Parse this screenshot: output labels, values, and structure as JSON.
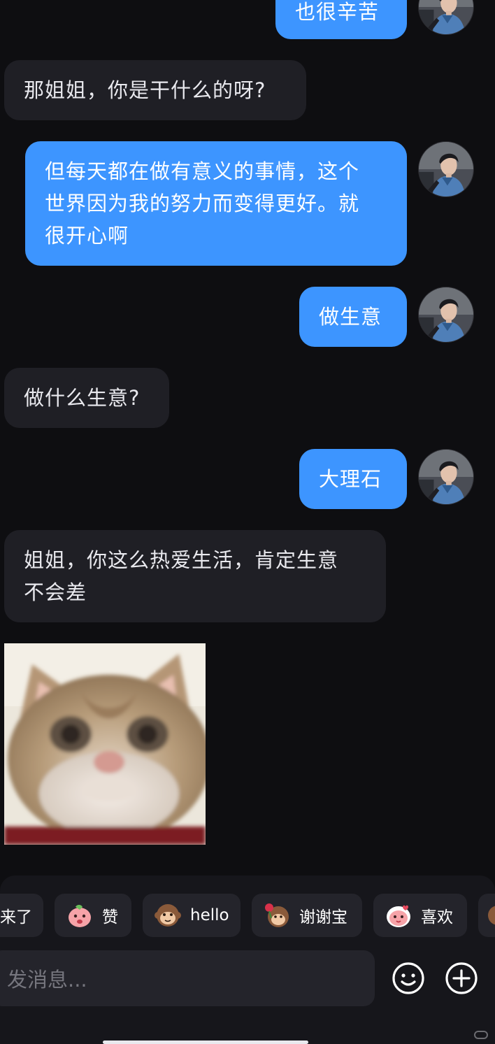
{
  "messages": [
    {
      "side": "out",
      "text": "也很辛苦"
    },
    {
      "side": "in",
      "text": "那姐姐，你是干什么的呀?"
    },
    {
      "side": "out",
      "text": "但每天都在做有意义的事情，这个\n世界因为我的努力而变得更好。就\n很开心啊"
    },
    {
      "side": "out",
      "text": "做生意"
    },
    {
      "side": "in",
      "text": "做什么生意?"
    },
    {
      "side": "out",
      "text": "大理石"
    },
    {
      "side": "in",
      "text": "姐姐，你这么热爱生活，肯定生意\n不会差"
    }
  ],
  "image_message": {
    "side": "in",
    "content": "cat-photo"
  },
  "quick_replies": [
    {
      "label": "来了",
      "icon": "emoji-sticker"
    },
    {
      "label": "赞",
      "icon": "pink-blob-sticker"
    },
    {
      "label": "hello",
      "icon": "monkey-sticker"
    },
    {
      "label": "谢谢宝",
      "icon": "monkey-rose-sticker"
    },
    {
      "label": "喜欢",
      "icon": "pink-blob-heart-sticker"
    }
  ],
  "composer": {
    "placeholder": "发消息...",
    "emoji_button": "smiley-icon",
    "add_button": "plus-circle-icon"
  },
  "colors": {
    "background": "#0e0e11",
    "outgoing_bubble": "#3d95ff",
    "incoming_bubble": "#1f1f25",
    "panel": "#16161b",
    "chip": "#24242b"
  }
}
